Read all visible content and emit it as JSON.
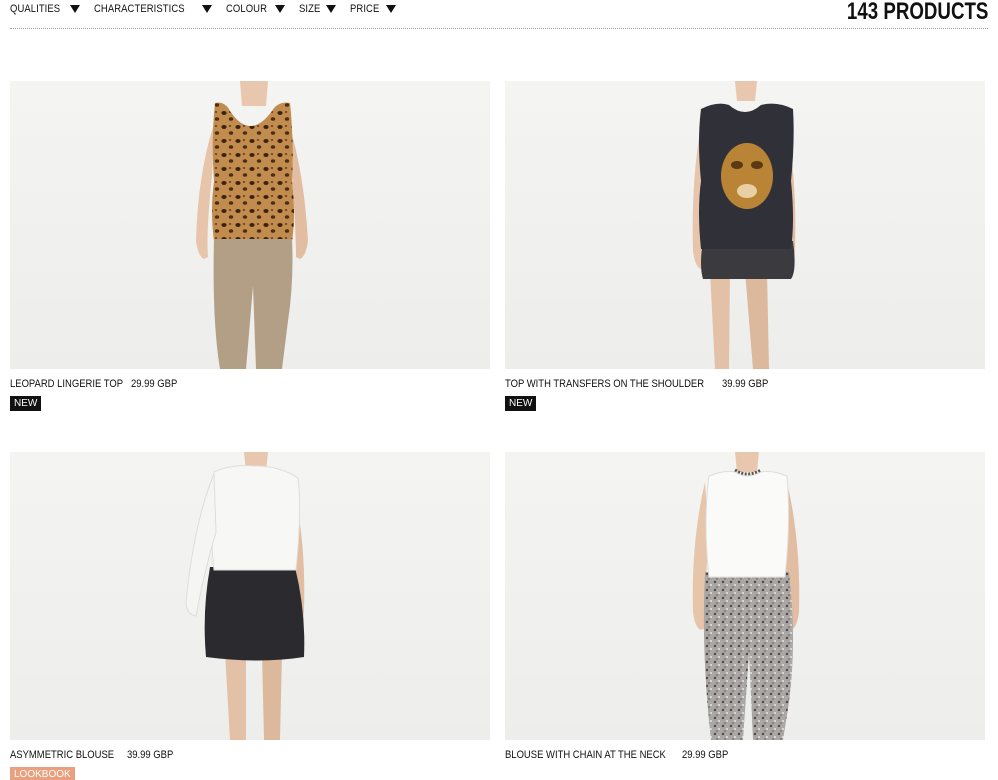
{
  "filters": [
    {
      "label": "QUALITIES",
      "icon": "triangle-down-icon"
    },
    {
      "label": "CHARACTERISTICS",
      "icon": "triangle-down-icon"
    },
    {
      "label": "COLOUR",
      "icon": "triangle-down-icon"
    },
    {
      "label": "SIZE",
      "icon": "triangle-down-icon"
    },
    {
      "label": "PRICE",
      "icon": "triangle-down-icon"
    }
  ],
  "product_count": "143 PRODUCTS",
  "products": [
    {
      "name": "LEOPARD LINGERIE TOP",
      "price": "29.99 GBP",
      "badge": "NEW"
    },
    {
      "name": "TOP WITH TRANSFERS ON THE SHOULDER",
      "price": "39.99 GBP",
      "badge": "NEW"
    },
    {
      "name": "ASYMMETRIC BLOUSE",
      "price": "39.99 GBP",
      "badge": "LOOKBOOK"
    },
    {
      "name": "BLOUSE WITH CHAIN AT THE NECK",
      "price": "29.99 GBP",
      "badge": ""
    }
  ],
  "colors": {
    "badge_new": "#111111",
    "badge_lookbook": "#e8a07e",
    "photo_bg": "#f0f0ee"
  }
}
